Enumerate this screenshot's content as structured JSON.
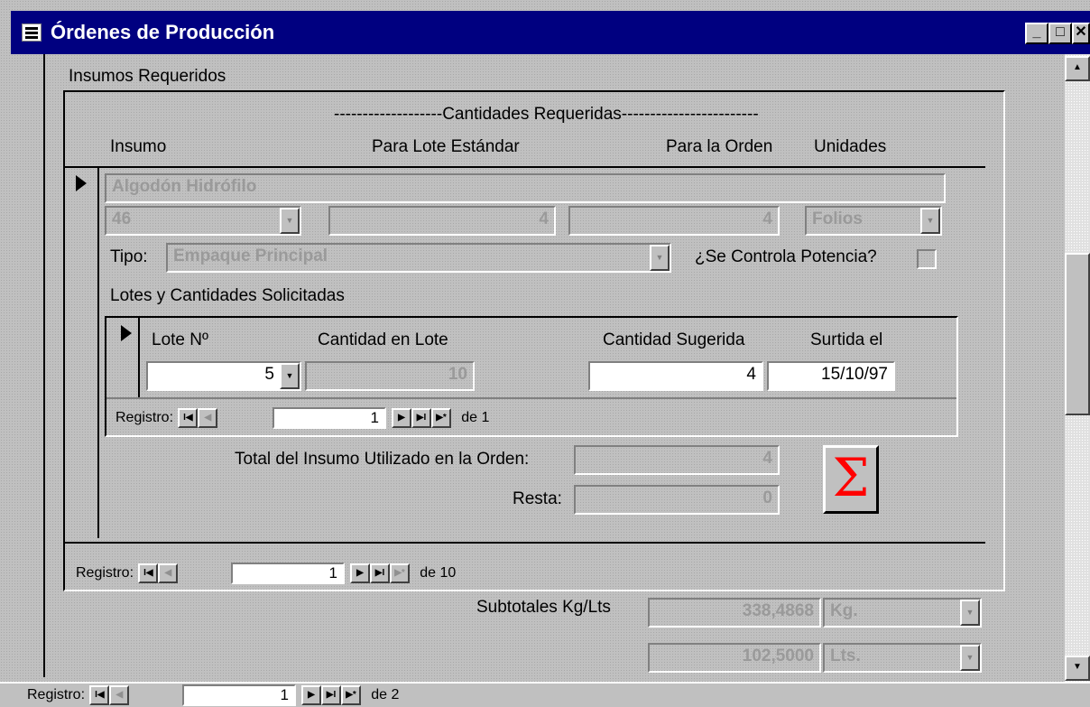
{
  "window": {
    "title": "Órdenes de Producción",
    "min": "_",
    "max": "□",
    "close": "✕"
  },
  "section_label": "Insumos Requeridos",
  "cantidades_header": "-------------------Cantidades Requeridas------------------------",
  "columns": {
    "insumo": "Insumo",
    "lote_estandar": "Para Lote Estándar",
    "para_orden": "Para la Orden",
    "unidades": "Unidades"
  },
  "insumo": {
    "name": "Algodón Hidrófilo",
    "code": "46",
    "lote_estandar": "4",
    "para_orden": "4",
    "unidades": "Folios"
  },
  "tipo": {
    "label": "Tipo:",
    "value": "Empaque Principal"
  },
  "potencia_label": "¿Se Controla Potencia?",
  "lotes_label": "Lotes y Cantidades Solicitadas",
  "lotes_cols": {
    "lote": "Lote Nº",
    "cant_lote": "Cantidad en Lote",
    "cant_sugerida": "Cantidad Sugerida",
    "surtida": "Surtida el"
  },
  "lote_row": {
    "lote": "5",
    "cant_lote": "10",
    "cant_sugerida": "4",
    "surtida": "15/10/97"
  },
  "nav_inner": {
    "label": "Registro:",
    "current": "1",
    "total": "de 1"
  },
  "total_label": "Total del Insumo Utilizado en la Orden:",
  "total_value": "4",
  "resta_label": "Resta:",
  "resta_value": "0",
  "sigma_label": "Σ",
  "nav_mid": {
    "label": "Registro:",
    "current": "1",
    "total": "de 10"
  },
  "subtotales_label": "Subtotales Kg/Lts",
  "subtotal_kg": {
    "value": "338,4868",
    "unit": "Kg."
  },
  "subtotal_lts": {
    "value": "102,5000",
    "unit": "Lts."
  },
  "nav_outer": {
    "label": "Registro:",
    "current": "1",
    "total": "de 2"
  },
  "nav_icons": {
    "first": "I◀",
    "prev": "◀",
    "next": "▶",
    "last": "▶I",
    "new": "▶*"
  }
}
